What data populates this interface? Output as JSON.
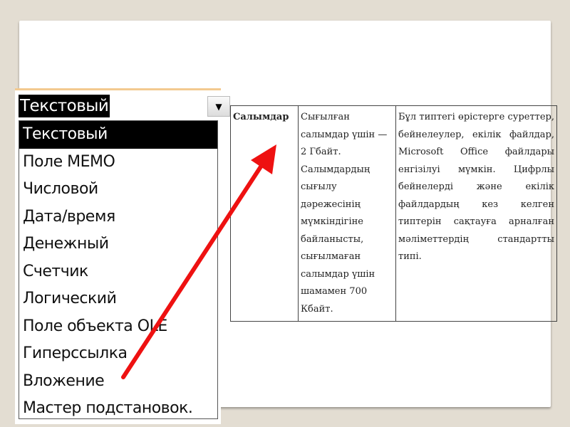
{
  "dropdown": {
    "selected_value": "Текстовый",
    "items": [
      "Текстовый",
      "Поле MEMO",
      "Числовой",
      "Дата/время",
      "Денежный",
      "Счетчик",
      "Логический",
      "Поле объекта OLE",
      "Гиперссылка",
      "Вложение",
      "Мастер подстановок."
    ],
    "highlighted_index": 0
  },
  "table": {
    "term": "Салымдар",
    "size": "Сығылған салымдар үшін — 2 Гбайт. Салымдардың сығылу дәрежесінің мүмкіндігіне байланысты, сығылмаған салымдар үшін шамамен 700 Кбайт.",
    "description": "Бұл типтегі өрістерге суреттер, бейнелеулер, екілік файлдар, Microsoft Office файлдары енгізілуі мүмкін. Цифрлы бейнелерді және екілік файлдардың кез келген типтерін сақтауға арналған мәліметтердің стандартты типі."
  },
  "colors": {
    "background": "#e3ddd2",
    "arrow": "#ee1111",
    "combo_border": "#f3c98f"
  }
}
